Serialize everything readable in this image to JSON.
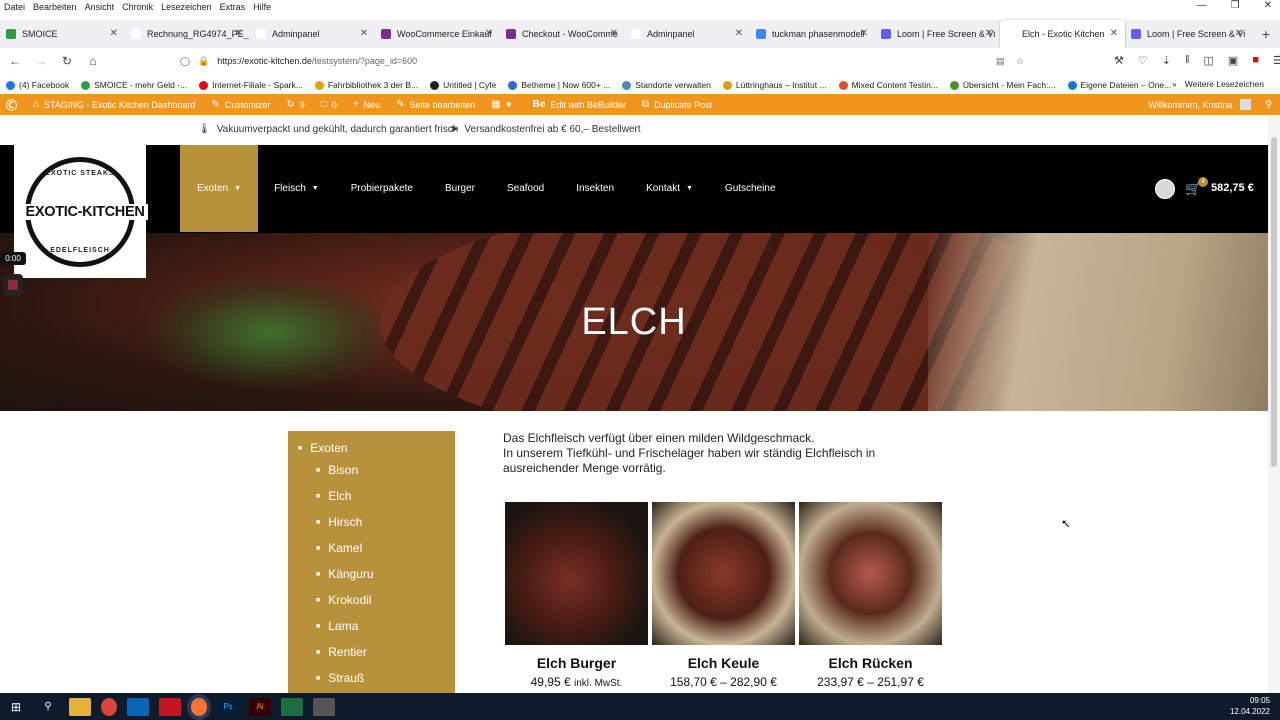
{
  "browser": {
    "menu": [
      "Datei",
      "Bearbeiten",
      "Ansicht",
      "Chronik",
      "Lesezeichen",
      "Extras",
      "Hilfe"
    ],
    "tabs": [
      {
        "label": "SMOICE",
        "color": "#2e9d44"
      },
      {
        "label": "Rechnung_RG4974_PE_Mass",
        "color": "#ffffff"
      },
      {
        "label": "Adminpanel",
        "color": "#ffffff"
      },
      {
        "label": "WooCommerce Einkauf",
        "color": "#7b2d8b"
      },
      {
        "label": "Checkout - WooComme",
        "color": "#7b2d8b"
      },
      {
        "label": "Adminpanel",
        "color": "#ffffff"
      },
      {
        "label": "tuckman phasenmodell",
        "color": "#4285f4"
      },
      {
        "label": "Loom | Free Screen & Vi",
        "color": "#625df5"
      },
      {
        "label": "Elch - Exotic Kitchen",
        "color": "#ffffff"
      },
      {
        "label": "Loom | Free Screen & Vi",
        "color": "#625df5"
      }
    ],
    "active_tab_index": 8,
    "url_domain": "https://exotic-kitchen.de",
    "url_path": "/testsystem/?page_id=600",
    "bookmarks": [
      "(4) Facebook",
      "SMOICE - mehr Geld -...",
      "Internet-Filiale - Spark...",
      "Fahrbibliothek 3 der B...",
      "Untitled | Cyfe",
      "Betheme | Now 600+ ...",
      "Standorte verwalten",
      "Lüttringhaus – Institut ...",
      "Mixed Content Testin...",
      "Übersicht - Mein Fach:...",
      "Eigene Dateien – One..."
    ],
    "other_bookmarks": "Weitere Lesezeichen"
  },
  "wp_admin": {
    "site": "STAGING - Exotic Kitchen Dashboard",
    "customizer": "Customizer",
    "updates": "9",
    "comments": "0",
    "new": "Neu",
    "edit_page": "Seite bearbeiten",
    "bebuilder": "Edit with BeBuilder",
    "duplicate": "Duplicate Post",
    "welcome": "Willkommen, Kristina"
  },
  "info": {
    "left": "Vakuumverpackt und gekühlt, dadurch garantiert frisch",
    "right": "Versandkostenfrei ab € 60,– Bestellwert"
  },
  "logo": {
    "title": "EXOTIC-KITCHEN",
    "top": "EXOTIC STEAKS",
    "bottom": "EDELFLEISCH"
  },
  "nav": [
    {
      "label": "Exoten",
      "caret": true
    },
    {
      "label": "Fleisch",
      "caret": true
    },
    {
      "label": "Probierpakete",
      "caret": false
    },
    {
      "label": "Burger",
      "caret": false
    },
    {
      "label": "Seafood",
      "caret": false
    },
    {
      "label": "Insekten",
      "caret": false
    },
    {
      "label": "Kontakt",
      "caret": true
    },
    {
      "label": "Gutscheine",
      "caret": false
    }
  ],
  "cart": {
    "count": "4",
    "total": "582,75 €"
  },
  "hero_title": "ELCH",
  "sidebar": {
    "heading": "Exoten",
    "items": [
      "Bison",
      "Elch",
      "Hirsch",
      "Kamel",
      "Känguru",
      "Krokodil",
      "Lama",
      "Rentier",
      "Strauß"
    ]
  },
  "intro": {
    "line1": "Das Elchfleisch verfügt über einen milden Wildgeschmack.",
    "line2": "In unserem Tiefkühl- und Frischelager haben wir ständig Elchfleisch in ausreichender Menge vorrätig."
  },
  "products": [
    {
      "name": "Elch Burger",
      "price": "49,95 €",
      "suffix": "inkl. MwSt."
    },
    {
      "name": "Elch Keule",
      "price": "158,70 € – 282,90 €",
      "suffix": ""
    },
    {
      "name": "Elch Rücken",
      "price": "233,97 € – 251,97 €",
      "suffix": ""
    }
  ],
  "loom_timer": "0:00",
  "clock": {
    "time": "09:05",
    "date": "12.04.2022"
  },
  "colors": {
    "accent": "#b8923a",
    "wp_bar": "#f0961e",
    "header": "#000000"
  }
}
